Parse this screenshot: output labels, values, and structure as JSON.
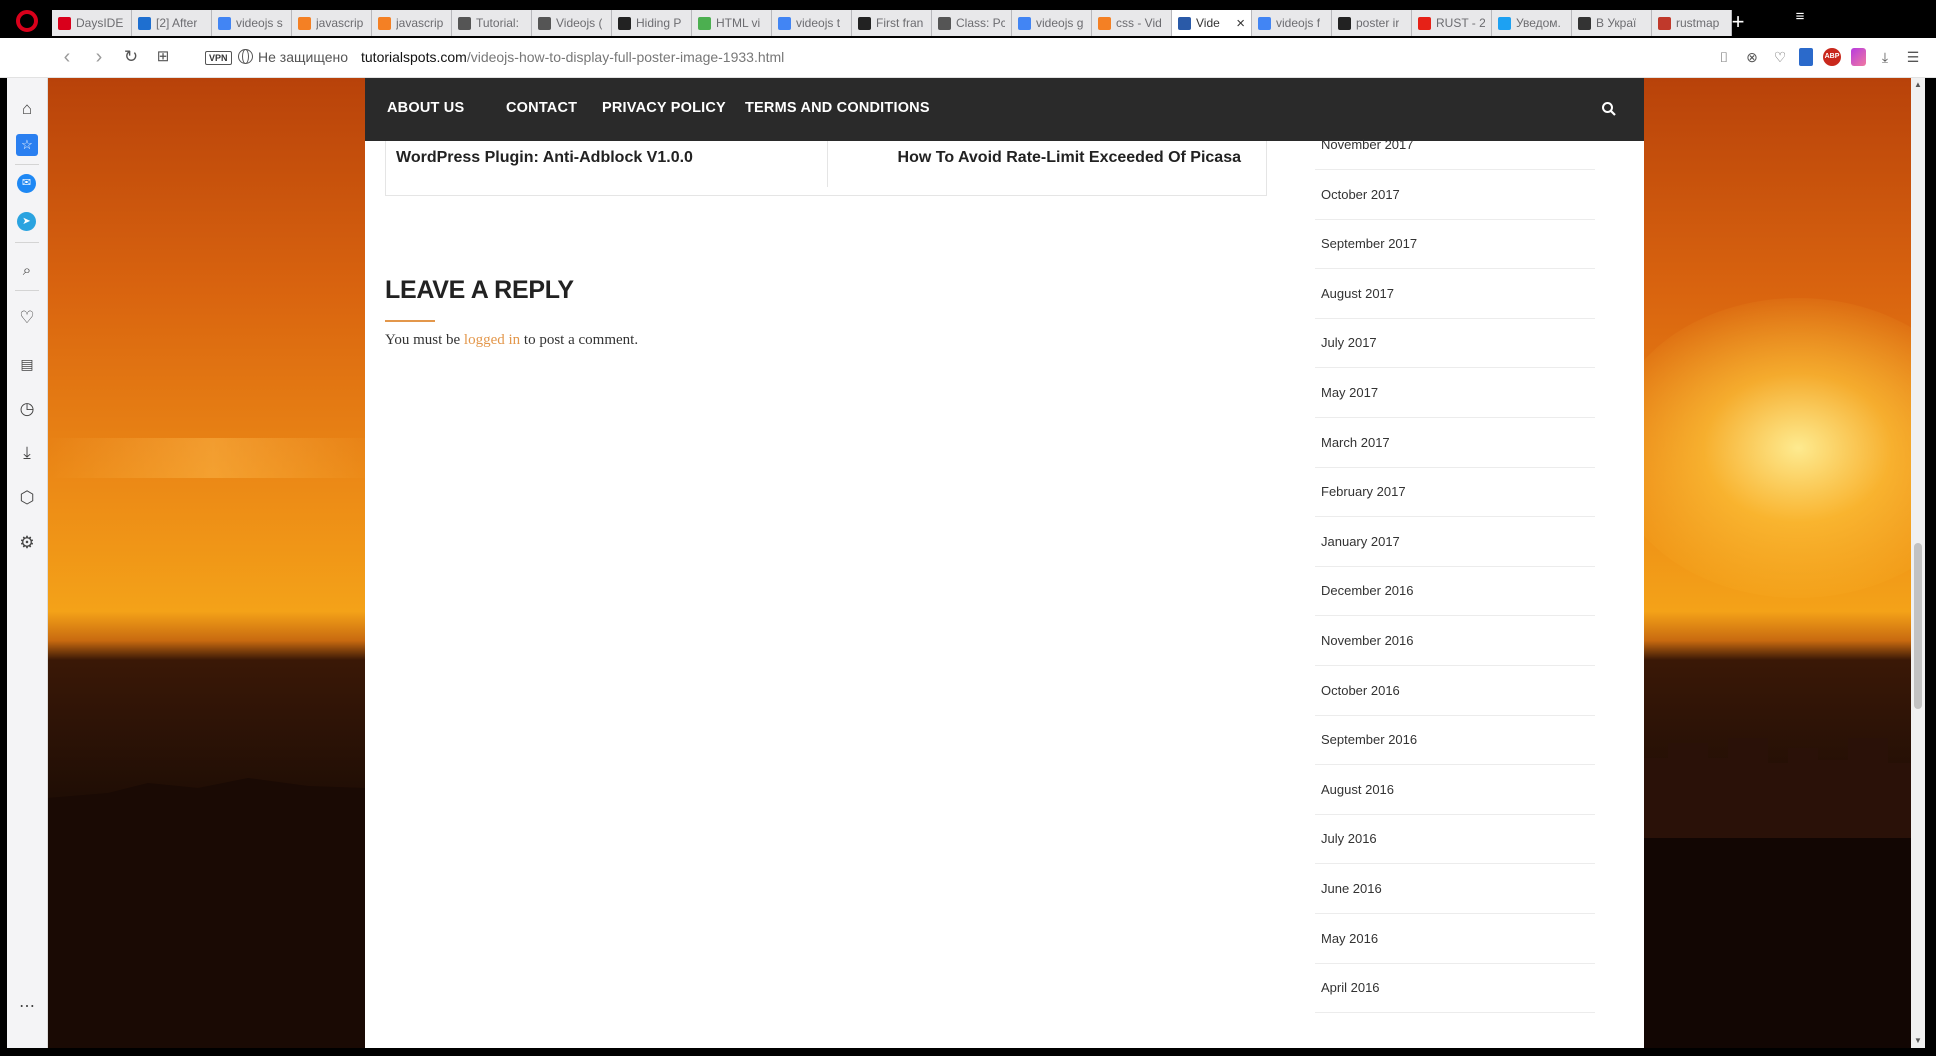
{
  "browser": {
    "tabs": [
      {
        "label": "DaysIDE",
        "icon": "letter-l-icon",
        "color": "#d9001b"
      },
      {
        "label": "[2] After",
        "icon": "trello-icon",
        "color": "#1e6fd0"
      },
      {
        "label": "videojs s",
        "icon": "google-icon",
        "color": "#4285f4"
      },
      {
        "label": "javascrip",
        "icon": "stackoverflow-icon",
        "color": "#f48024"
      },
      {
        "label": "javascrip",
        "icon": "stackoverflow-icon",
        "color": "#f48024"
      },
      {
        "label": "Tutorial:",
        "icon": "document-icon",
        "color": "#555555"
      },
      {
        "label": "Videojs (",
        "icon": "document-icon",
        "color": "#555555"
      },
      {
        "label": "Hiding P",
        "icon": "github-icon",
        "color": "#222222"
      },
      {
        "label": "HTML vi",
        "icon": "w3schools-icon",
        "color": "#4caf50"
      },
      {
        "label": "videojs t",
        "icon": "google-icon",
        "color": "#4285f4"
      },
      {
        "label": "First fran",
        "icon": "github-icon",
        "color": "#222222"
      },
      {
        "label": "Class: Pc",
        "icon": "document-icon",
        "color": "#555555"
      },
      {
        "label": "videojs g",
        "icon": "google-icon",
        "color": "#4285f4"
      },
      {
        "label": "css - Vid",
        "icon": "stackoverflow-icon",
        "color": "#f48024"
      },
      {
        "label": "Vide",
        "icon": "ts-icon",
        "color": "#2a5aa8",
        "active": true
      },
      {
        "label": "videojs f",
        "icon": "google-icon",
        "color": "#4285f4"
      },
      {
        "label": "poster ir",
        "icon": "github-icon",
        "color": "#222222"
      },
      {
        "label": "RUST - 2",
        "icon": "youtube-icon",
        "color": "#e62117"
      },
      {
        "label": "Уведом.",
        "icon": "twitter-icon",
        "color": "#1da1f2"
      },
      {
        "label": "В Украї",
        "icon": "news-icon",
        "color": "#333333"
      },
      {
        "label": "rustmap",
        "icon": "rust-icon",
        "color": "#c0392b"
      }
    ],
    "address": {
      "security": "Не защищено",
      "domain": "tutorialspots.com",
      "path": "/videojs-how-to-display-full-poster-image-1933.html",
      "vpn_label": "VPN"
    },
    "extensions": {
      "abp_label": "ABP"
    }
  },
  "page": {
    "nav": {
      "items": [
        "ABOUT US",
        "CONTACT",
        "PRIVACY POLICY",
        "TERMS AND CONDITIONS"
      ]
    },
    "post_nav": {
      "prev": "WordPress Plugin: Anti-Adblock V1.0.0",
      "next": "How To Avoid Rate-Limit Exceeded Of Picasa"
    },
    "reply": {
      "title": "LEAVE A REPLY",
      "prefix": "You must be ",
      "link": "logged in",
      "suffix": " to post a comment."
    },
    "archives": [
      "November 2017",
      "October 2017",
      "September 2017",
      "August 2017",
      "July 2017",
      "May 2017",
      "March 2017",
      "February 2017",
      "January 2017",
      "December 2016",
      "November 2016",
      "October 2016",
      "September 2016",
      "August 2016",
      "July 2016",
      "June 2016",
      "May 2016",
      "April 2016"
    ]
  },
  "colors": {
    "accent": "#e3974b",
    "nav_bg": "#2a2a2a",
    "browser_red": "#d9001b"
  }
}
